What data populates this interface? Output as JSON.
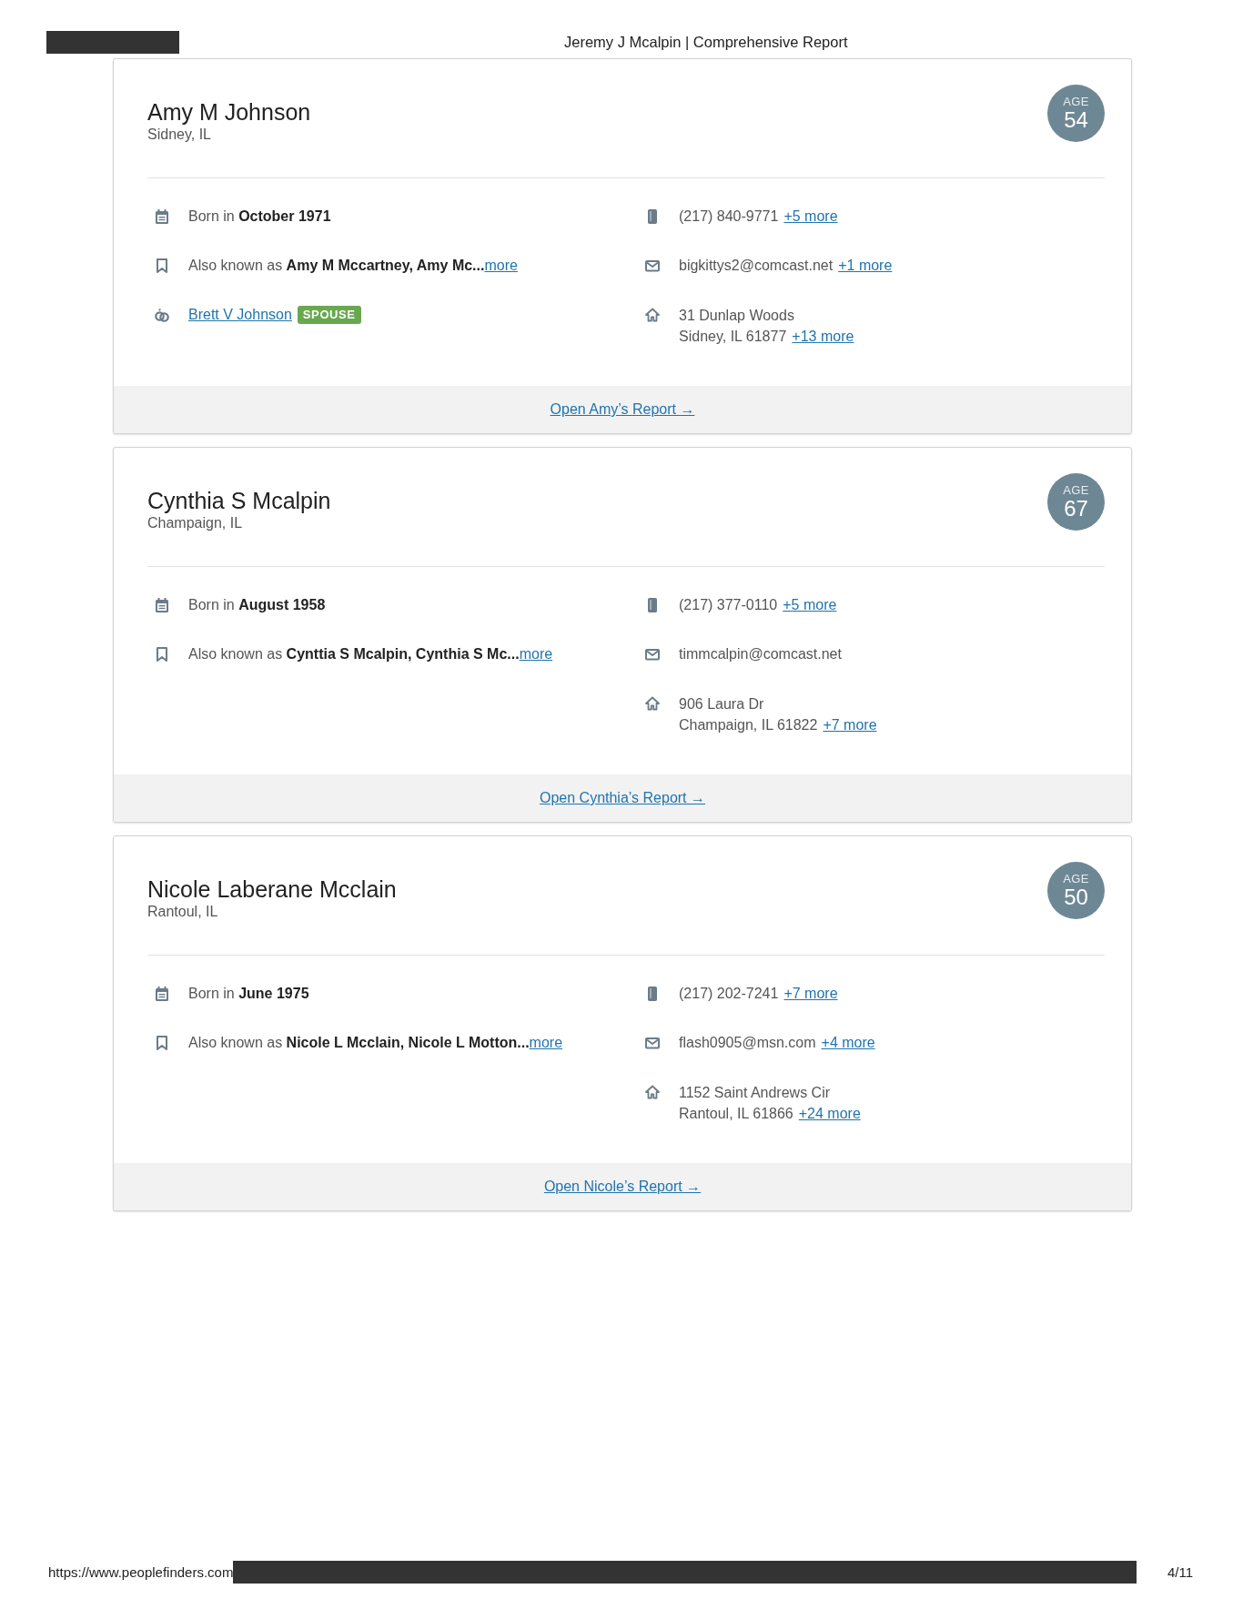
{
  "page_header": {
    "title": "Jeremy J Mcalpin | Comprehensive Report"
  },
  "people": [
    {
      "name": "Amy M Johnson",
      "location": "Sidney, IL",
      "age_label": "AGE",
      "age": "54",
      "personal_details": [
        {
          "kind": "born",
          "text": "Born in **October 1971**"
        },
        {
          "kind": "aka",
          "text": "Also known as **Amy M Mccartney, Amy Mc...**",
          "more": "more"
        },
        {
          "kind": "relative",
          "name": "Brett V Johnson",
          "relation": "SPOUSE"
        }
      ],
      "contact_details": [
        {
          "kind": "phone",
          "text": "(217) 840-9771",
          "more": "+5 more"
        },
        {
          "kind": "email",
          "text": "bigkittys2@comcast.net",
          "more": "+1 more"
        },
        {
          "kind": "address",
          "lines": [
            "31 Dunlap Woods",
            "Sidney, IL 61877"
          ],
          "more": "+13 more"
        }
      ],
      "report_link": "Open Amy’s Report →"
    },
    {
      "name": "Cynthia S Mcalpin",
      "location": "Champaign, IL",
      "age_label": "AGE",
      "age": "67",
      "personal_details": [
        {
          "kind": "born",
          "text": "Born in **August 1958**"
        },
        {
          "kind": "aka",
          "text": "Also known as **Cynttia S Mcalpin, Cynthia S Mc...**",
          "more": "more"
        }
      ],
      "contact_details": [
        {
          "kind": "phone",
          "text": "(217) 377-0110",
          "more": "+5 more"
        },
        {
          "kind": "email",
          "text": "timmcalpin@comcast.net"
        },
        {
          "kind": "address",
          "lines": [
            "906 Laura Dr",
            "Champaign, IL 61822"
          ],
          "more": "+7 more"
        }
      ],
      "report_link": "Open Cynthia’s Report →"
    },
    {
      "name": "Nicole Laberane Mcclain",
      "location": "Rantoul, IL",
      "age_label": "AGE",
      "age": "50",
      "personal_details": [
        {
          "kind": "born",
          "text": "Born in **June 1975**"
        },
        {
          "kind": "aka",
          "text": "Also known as **Nicole L Mcclain, Nicole L Motton...**",
          "more": "more"
        }
      ],
      "contact_details": [
        {
          "kind": "phone",
          "text": "(217) 202-7241",
          "more": "+7 more"
        },
        {
          "kind": "email",
          "text": "flash0905@msn.com",
          "more": "+4 more"
        },
        {
          "kind": "address",
          "lines": [
            "1152 Saint Andrews Cir",
            "Rantoul, IL 61866"
          ],
          "more": "+24 more"
        }
      ],
      "report_link": "Open Nicole’s Report →"
    }
  ],
  "footer": {
    "url": "https://www.peoplefinders.com",
    "page": "4/11"
  }
}
